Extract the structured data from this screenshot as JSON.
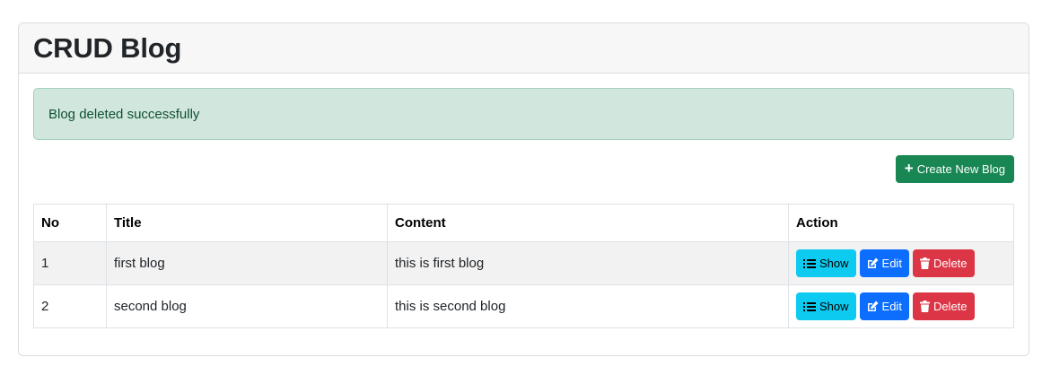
{
  "header": {
    "title": "CRUD Blog"
  },
  "alert": {
    "message": "Blog deleted successfully"
  },
  "toolbar": {
    "create_label": "Create New Blog"
  },
  "table": {
    "columns": [
      "No",
      "Title",
      "Content",
      "Action"
    ],
    "rows": [
      {
        "no": "1",
        "title": "first blog",
        "content": "this is first blog"
      },
      {
        "no": "2",
        "title": "second blog",
        "content": "this is second blog"
      }
    ],
    "actions": {
      "show": "Show",
      "edit": "Edit",
      "delete": "Delete"
    }
  },
  "colors": {
    "success": "#198754",
    "info": "#0dcaf0",
    "primary": "#0d6efd",
    "danger": "#dc3545",
    "alert_bg": "#d1e7dd"
  },
  "icons": {
    "create": "plus-icon",
    "show": "list-icon",
    "edit": "edit-icon",
    "delete": "trash-icon"
  }
}
